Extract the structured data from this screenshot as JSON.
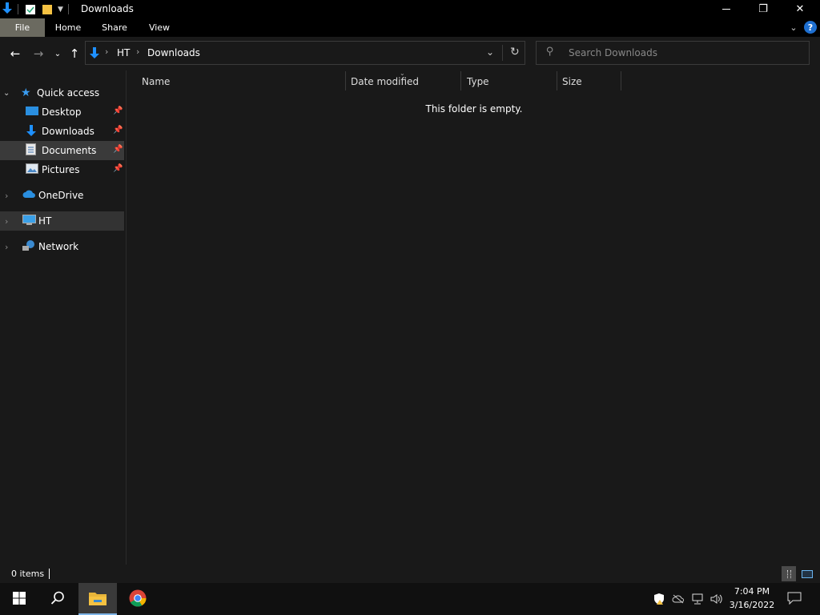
{
  "window": {
    "title": "Downloads",
    "minimize": "—",
    "restore": "❐",
    "close": "✕"
  },
  "ribbon": {
    "tabs": [
      "File",
      "Home",
      "Share",
      "View"
    ],
    "help": "?"
  },
  "address": {
    "crumbs": [
      "HT",
      "Downloads"
    ],
    "search_placeholder": "Search Downloads"
  },
  "sidebar": {
    "quick_access": "Quick access",
    "pinned": [
      "Desktop",
      "Downloads",
      "Documents",
      "Pictures"
    ],
    "onedrive": "OneDrive",
    "this_pc": "HT",
    "network": "Network"
  },
  "columns": [
    "Name",
    "Date modified",
    "Type",
    "Size"
  ],
  "content": {
    "empty_message": "This folder is empty."
  },
  "status": {
    "items": "0 items"
  },
  "taskbar": {
    "time": "7:04 PM",
    "date": "3/16/2022"
  },
  "colors": {
    "accent": "#1e90ff",
    "folder_yellow": "#f5c242",
    "bg": "#191919",
    "file_tab": "#6b6a60"
  }
}
